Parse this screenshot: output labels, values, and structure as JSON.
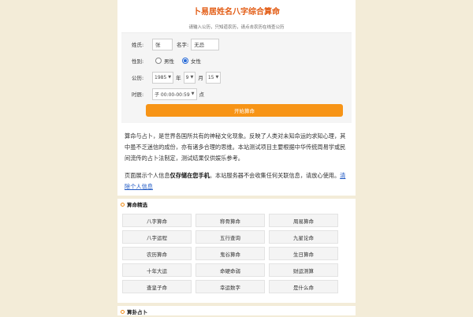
{
  "header": {
    "title": "卜易居姓名八字综合算命",
    "subtitle": "请输入公历，只知道农历，请点击农历在线查公历"
  },
  "form": {
    "surname_label": "姓氏:",
    "surname_value": "张",
    "name_label": "名字:",
    "name_value": "无忌",
    "gender_label": "性别:",
    "gender_options": [
      "男性",
      "女性"
    ],
    "gender_selected": "女性",
    "date_label": "公历:",
    "year": "1985",
    "year_unit": "年",
    "month": "9",
    "month_unit": "月",
    "day": "15",
    "time_label": "时辰:",
    "hour": "子 00:00-00:59",
    "hour_unit": "点",
    "submit_label": "开始算命"
  },
  "description": {
    "para1": "算命与占卜，是世界各国所共有的神秘文化现象。反映了人类对未知命运的求知心理，其中虽不乏迷信的成份，亦有诸多合理的思维。本站测试项目主要根据中华传统周易学或民间流传的占卜法制定，测试结果仅供娱乐参考。",
    "para2_prefix": "页面展示个人信息",
    "para2_bold": "仅存储在您手机",
    "para2_suffix": "。本站服务器不会收集任何关联信息，请放心使用。",
    "clear_link": "清除个人信息"
  },
  "sections": {
    "fortune_title": "算命精选",
    "fortune_items": [
      "八字算命",
      "称骨算命",
      "周易算命",
      "八字运程",
      "五行查询",
      "九星论命",
      "农历算命",
      "鬼谷算命",
      "生日算命",
      "十年大运",
      "命硬命弱",
      "财运测算",
      "查皇子命",
      "幸运数字",
      "是什么命"
    ],
    "divination_title": "算卦占卜"
  }
}
